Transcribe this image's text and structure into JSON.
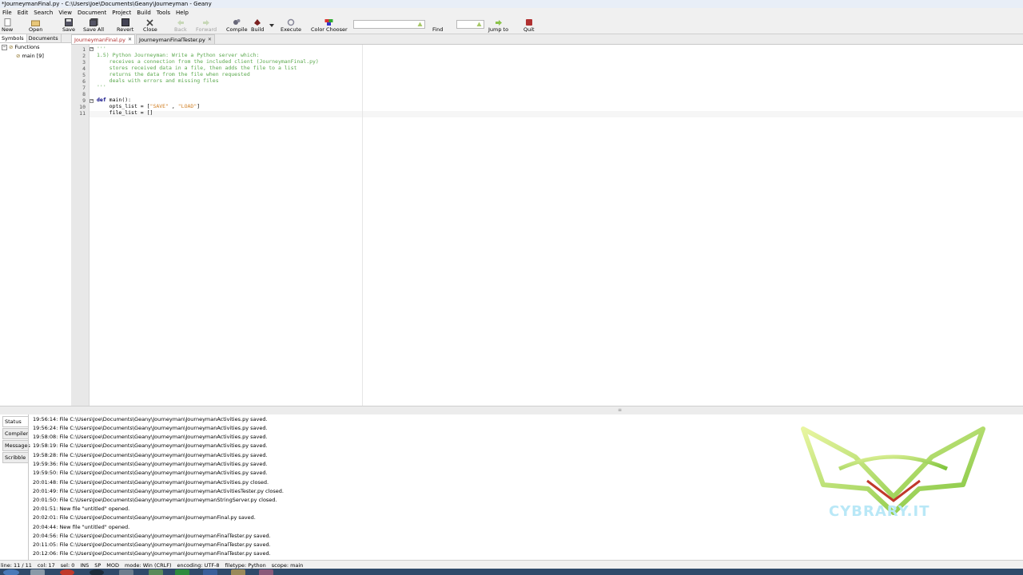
{
  "window": {
    "title": "*JourneymanFinal.py - C:\\Users\\Joe\\Documents\\Geany\\Journeyman - Geany"
  },
  "menu": [
    "File",
    "Edit",
    "Search",
    "View",
    "Document",
    "Project",
    "Build",
    "Tools",
    "Help"
  ],
  "toolbar": {
    "new": "New",
    "open": "Open",
    "save": "Save",
    "save_all": "Save All",
    "revert": "Revert",
    "close": "Close",
    "back": "Back",
    "forward": "Forward",
    "compile": "Compile",
    "build": "Build",
    "execute": "Execute",
    "color_chooser": "Color Chooser",
    "find": "Find",
    "jump_to": "Jump to",
    "quit": "Quit"
  },
  "sidebar": {
    "tabs": [
      "Symbols",
      "Documents"
    ],
    "tree": {
      "group": "Functions",
      "item": "main [9]"
    }
  },
  "editor": {
    "tabs": [
      {
        "label": "JourneymanFinal.py",
        "active": true
      },
      {
        "label": "JourneymanFinalTester.py",
        "active": false
      }
    ],
    "line_numbers": [
      "1",
      "2",
      "3",
      "4",
      "5",
      "6",
      "7",
      "8",
      "9",
      "10",
      "11"
    ],
    "lines": [
      {
        "text": "'''",
        "style": "doc"
      },
      {
        "text": "1.5) Python Journeyman: Write a Python server which:",
        "style": "doc"
      },
      {
        "text": "    receives a connection from the included client (JourneymanFinal.py)",
        "style": "doc"
      },
      {
        "text": "    stores received data in a file, then adds the file to a list",
        "style": "doc"
      },
      {
        "text": "    returns the data from the file when requested",
        "style": "doc"
      },
      {
        "text": "    deals with errors and missing files",
        "style": "doc"
      },
      {
        "text": "'''",
        "style": "doc"
      },
      {
        "text": "",
        "style": "plain"
      },
      {
        "kw": "def",
        "rest": " main():",
        "style": "def"
      },
      {
        "pre": "    opts_list = [",
        "s1": "\"SAVE\"",
        "mid": " , ",
        "s2": "\"LOAD\"",
        "post": "]",
        "style": "list"
      },
      {
        "text": "    file_list = []",
        "style": "plain"
      }
    ]
  },
  "messages": {
    "tabs": [
      "Status",
      "Compiler",
      "Messages",
      "Scribble"
    ],
    "lines": [
      "19:56:14: File C:\\Users\\Joe\\Documents\\Geany\\Journeyman\\JourneymanActivities.py saved.",
      "19:56:24: File C:\\Users\\Joe\\Documents\\Geany\\Journeyman\\JourneymanActivities.py saved.",
      "19:58:08: File C:\\Users\\Joe\\Documents\\Geany\\Journeyman\\JourneymanActivities.py saved.",
      "19:58:19: File C:\\Users\\Joe\\Documents\\Geany\\Journeyman\\JourneymanActivities.py saved.",
      "19:58:28: File C:\\Users\\Joe\\Documents\\Geany\\Journeyman\\JourneymanActivities.py saved.",
      "19:59:36: File C:\\Users\\Joe\\Documents\\Geany\\Journeyman\\JourneymanActivities.py saved.",
      "19:59:50: File C:\\Users\\Joe\\Documents\\Geany\\Journeyman\\JourneymanActivities.py saved.",
      "20:01:48: File C:\\Users\\Joe\\Documents\\Geany\\Journeyman\\JourneymanActivities.py closed.",
      "20:01:49: File C:\\Users\\Joe\\Documents\\Geany\\Journeyman\\JourneymanActivitiesTester.py closed.",
      "20:01:50: File C:\\Users\\Joe\\Documents\\Geany\\Journeyman\\JourneymanStringServer.py closed.",
      "20:01:51: New file \"untitled\" opened.",
      "20:02:01: File C:\\Users\\Joe\\Documents\\Geany\\Journeyman\\JourneymanFinal.py saved.",
      "20:04:44: New file \"untitled\" opened.",
      "20:04:56: File C:\\Users\\Joe\\Documents\\Geany\\Journeyman\\JourneymanFinalTester.py saved.",
      "20:11:05: File C:\\Users\\Joe\\Documents\\Geany\\Journeyman\\JourneymanFinalTester.py saved.",
      "20:12:06: File C:\\Users\\Joe\\Documents\\Geany\\Journeyman\\JourneymanFinalTester.py saved."
    ]
  },
  "watermark": {
    "text": "CYBRARY.IT"
  },
  "statusbar": {
    "line": "line: 11 / 11",
    "col": "col: 17",
    "sel": "sel: 0",
    "ins": "INS",
    "sp": "SP",
    "mod": "MOD",
    "mode": "mode: Win (CRLF)",
    "encoding": "encoding: UTF-8",
    "filetype": "filetype: Python",
    "scope": "scope: main"
  },
  "colors": {
    "docstring": "#5aa84c",
    "keyword": "#00007f",
    "string": "#d2832a",
    "active_tab": "#b03030"
  }
}
